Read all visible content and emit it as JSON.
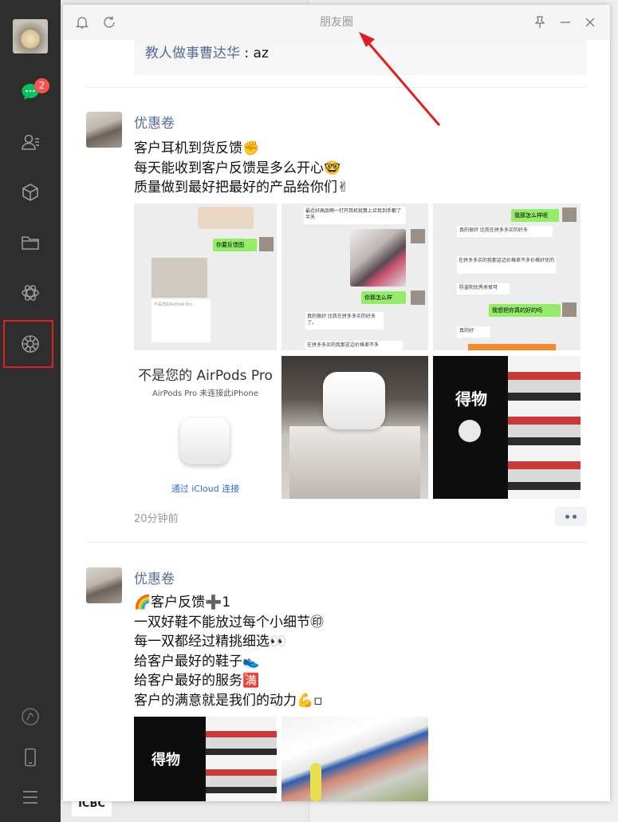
{
  "window": {
    "title": "朋友圈"
  },
  "sidebar": {
    "chat_badge": "2"
  },
  "background": {
    "bank_label": "ICBC"
  },
  "feed": {
    "prev_comment": {
      "user": "教人做事曹达华",
      "sep": " : ",
      "text": "az"
    },
    "posts": [
      {
        "user": "优惠卷",
        "lines": [
          "客户耳机到货反馈✊",
          "每天能收到客户反馈是多么开心🤓",
          "质量做到最好把最好的产品给你们✌"
        ],
        "time": "20分钟前",
        "images": {
          "chat1": {
            "bubble": "你要反馈图",
            "card": "不是您的AirPods Pro"
          },
          "chat2": {
            "top": "最近好高品啊一打开耳机就算上买我到手都了半天",
            "bubble": "你那怎么样",
            "text1": "真的很好 比我在拼多多买的好多了。",
            "text2": "在拼多多买的我那这边价格差不多"
          },
          "chat3": {
            "bubble1": "我那怎么样呢",
            "text1": "真的很好 比我在拼多多买的好多",
            "text2": "在拼多多买的我那这边价格差不多价格好优的",
            "text3": "防盗和优秀来很可",
            "bubble2": "我想把你真的好的吗",
            "text4": "真的好"
          },
          "airpods": {
            "title": "不是您的 AirPods Pro",
            "sub": "AirPods Pro 未连接此iPhone",
            "link": "通过 iCloud 连接"
          },
          "dewu": {
            "brand": "得物"
          }
        }
      },
      {
        "user": "优惠卷",
        "lines": [
          "🌈客户反馈➕1",
          "一双好鞋不能放过每个小细节㊞",
          "每一双都经过精挑细选👀",
          "给客户最好的鞋子👟",
          "给客户最好的服务🈵",
          "客户的满意就是我们的动力💪▫"
        ],
        "images": {
          "dewu": {
            "brand": "得物"
          }
        }
      }
    ]
  },
  "colors": {
    "accent_link": "#576b95",
    "sidebar_bg": "#2e2e2e",
    "badge": "#fa5151",
    "highlight": "#e02020",
    "wechat_green": "#95ec69"
  },
  "icons": [
    "bell-icon",
    "refresh-icon",
    "pin-icon",
    "minimize-icon",
    "close-icon",
    "chat-icon",
    "contacts-icon",
    "favorites-icon",
    "folder-icon",
    "miniprogram-icon",
    "moments-icon",
    "channels-icon",
    "phone-icon",
    "menu-icon"
  ]
}
